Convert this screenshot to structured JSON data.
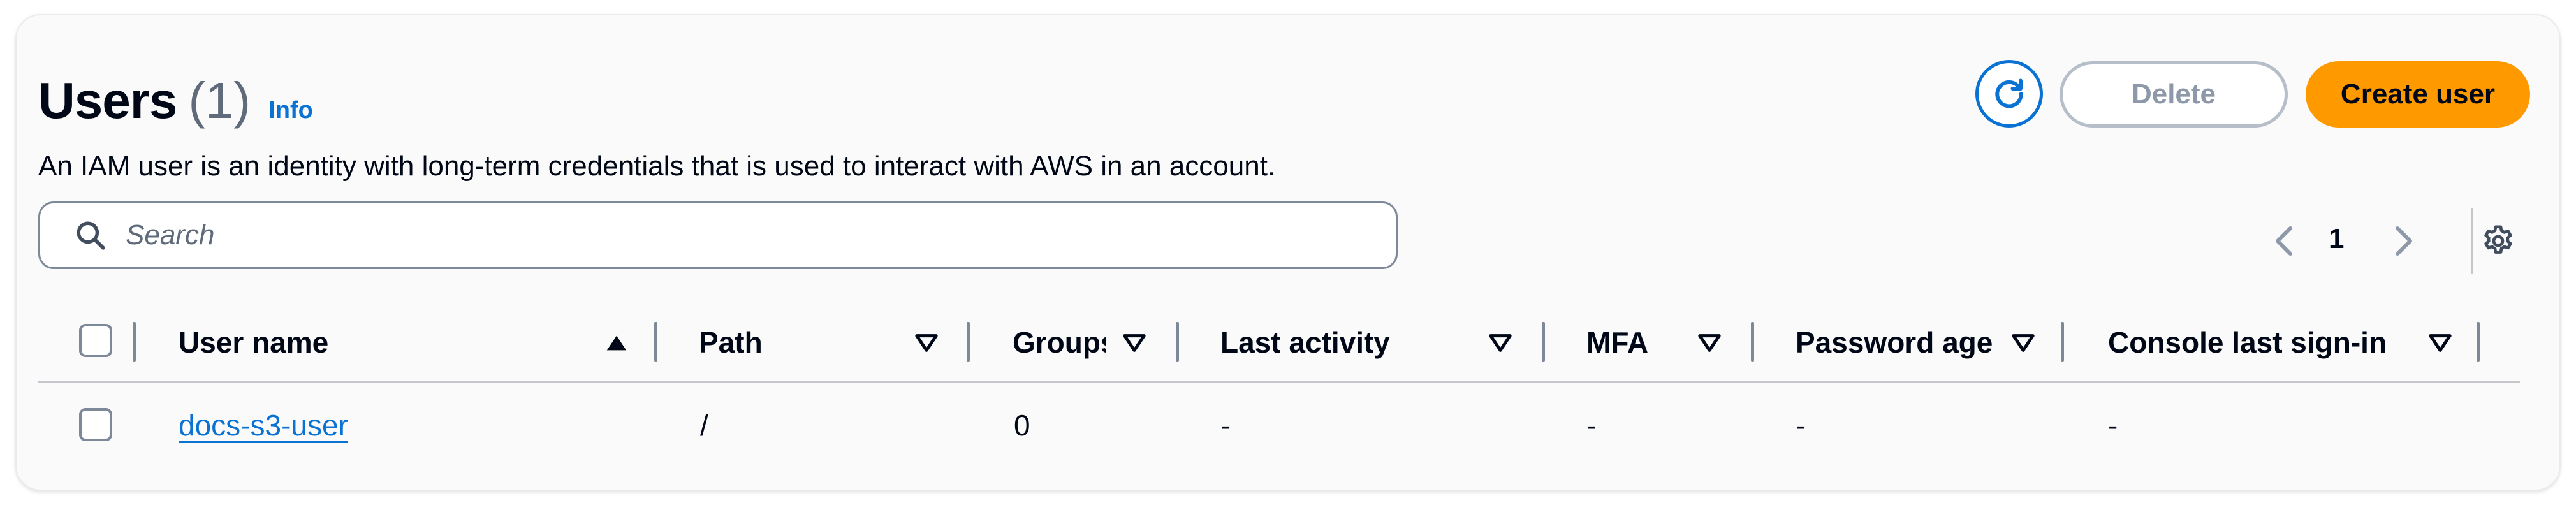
{
  "header": {
    "title": "Users",
    "count": "(1)",
    "info_label": "Info",
    "description": "An IAM user is an identity with long-term credentials that is used to interact with AWS in an account.",
    "refresh_icon": "refresh-icon",
    "delete_label": "Delete",
    "create_label": "Create user"
  },
  "search": {
    "placeholder": "Search",
    "value": "",
    "icon": "search-icon"
  },
  "pagination": {
    "current_page": "1",
    "prev_icon": "chevron-left-icon",
    "next_icon": "chevron-right-icon",
    "settings_icon": "gear-icon"
  },
  "table": {
    "columns": [
      {
        "label": "User name",
        "sort": "ascending"
      },
      {
        "label": "Path",
        "sort": "none"
      },
      {
        "label": "Groups",
        "sort": "none"
      },
      {
        "label": "Last activity",
        "sort": "none"
      },
      {
        "label": "MFA",
        "sort": "none"
      },
      {
        "label": "Password age",
        "sort": "none"
      },
      {
        "label": "Console last sign-in",
        "sort": "none"
      }
    ],
    "rows": [
      {
        "user_name": "docs-s3-user",
        "path": "/",
        "groups": "0",
        "last_activity": "-",
        "mfa": "-",
        "password_age": "-",
        "console_last_sign_in": "-"
      }
    ]
  },
  "colors": {
    "accent": "#0972d3",
    "primary_button": "#ff9900",
    "disabled_border": "#b6bec9",
    "text": "#000716"
  }
}
